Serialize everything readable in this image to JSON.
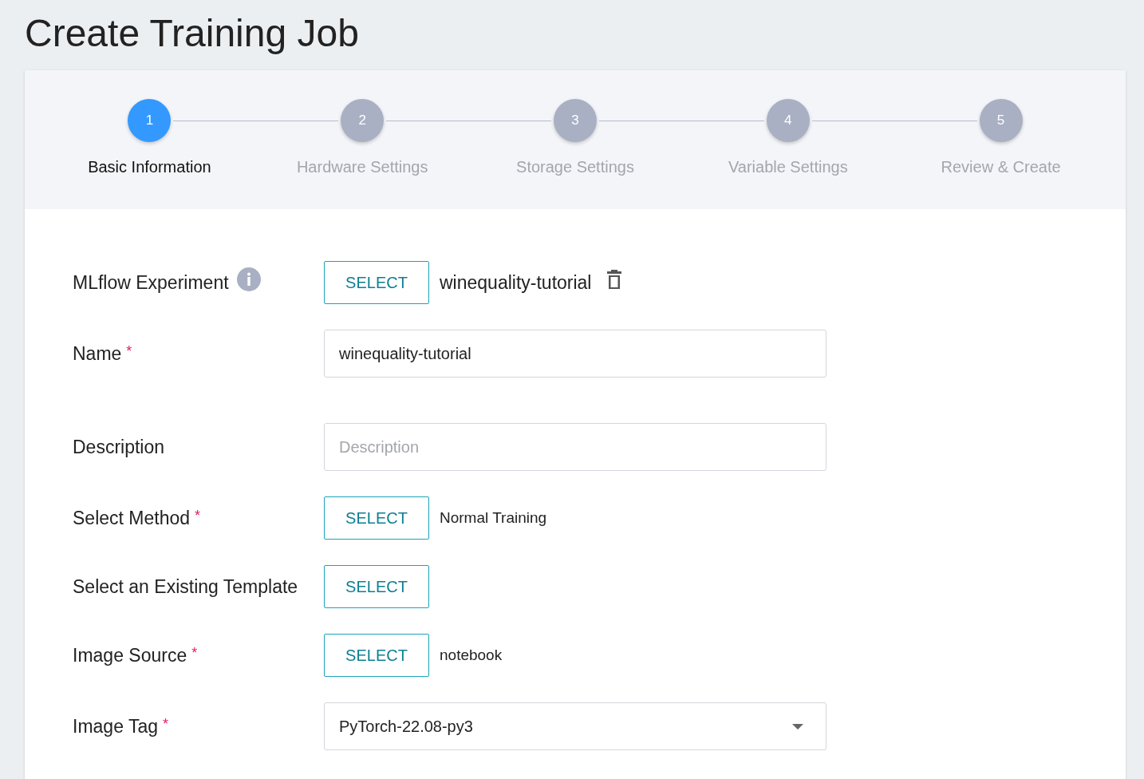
{
  "title": "Create Training Job",
  "steps": [
    {
      "number": "1",
      "label": "Basic Information",
      "selected": true
    },
    {
      "number": "2",
      "label": "Hardware Settings",
      "selected": false
    },
    {
      "number": "3",
      "label": "Storage Settings",
      "selected": false
    },
    {
      "number": "4",
      "label": "Variable Settings",
      "selected": false
    },
    {
      "number": "5",
      "label": "Review & Create",
      "selected": false
    }
  ],
  "fields": [
    {
      "kind": "select",
      "label": "MLflow Experiment",
      "info": true,
      "button": "SELECT",
      "value": "winequality-tutorial",
      "removable": true
    },
    {
      "kind": "input",
      "label": "Name",
      "required_mark": "*",
      "value": "winequality-tutorial"
    },
    {
      "kind": "input",
      "label": "Description",
      "placeholder": "Description"
    },
    {
      "kind": "select",
      "label": "Select Method",
      "required_mark": "*",
      "button": "SELECT",
      "value": "Normal Training"
    },
    {
      "kind": "select",
      "label": "Select an Existing Template",
      "button": "SELECT"
    },
    {
      "kind": "select",
      "label": "Image Source",
      "required_mark": "*",
      "button": "SELECT",
      "value": "notebook"
    },
    {
      "kind": "dropdown",
      "label": "Image Tag",
      "required_mark": "*",
      "value": "PyTorch-22.08-py3"
    }
  ]
}
